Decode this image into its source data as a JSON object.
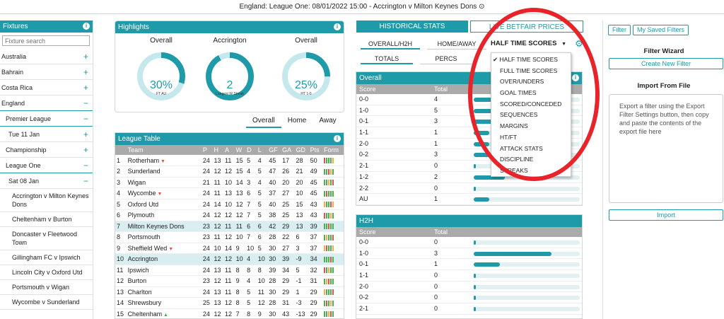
{
  "topbar": {
    "title": "England: League One: 08/01/2022 15:00 - Accrington v Milton Keynes Dons",
    "icon": "clock-icon"
  },
  "fixtures": {
    "title": "Fixtures",
    "search_placeholder": "Fixture search",
    "countries": [
      {
        "label": "Australia",
        "toggle": "+"
      },
      {
        "label": "Bahrain",
        "toggle": "+"
      },
      {
        "label": "Costa Rica",
        "toggle": "+"
      },
      {
        "label": "England",
        "toggle": "−"
      }
    ],
    "leagues": [
      {
        "label": "Premier League",
        "toggle": "−"
      },
      {
        "label": "Tue 11 Jan",
        "toggle": "+"
      },
      {
        "label": "Championship",
        "toggle": "+"
      },
      {
        "label": "League One",
        "toggle": "−"
      },
      {
        "label": "Sat 08 Jan",
        "toggle": "−"
      }
    ],
    "matches": [
      "Accrington v Milton Keynes Dons",
      "Cheltenham v Burton",
      "Doncaster v Fleetwood Town",
      "Gillingham FC v Ipswich",
      "Lincoln City v Oxford Utd",
      "Portsmouth v Wigan",
      "Wycombe v Sunderland"
    ]
  },
  "highlights": {
    "title": "Highlights",
    "gauges": [
      {
        "label": "Overall",
        "value": "30%",
        "sub": "FT AU",
        "pct": 0.3
      },
      {
        "label": "Accrington",
        "value": "2",
        "sub": "Longest W Streak",
        "pct": 0.92
      },
      {
        "label": "Overall",
        "value": "25%",
        "sub": "HT 1-0",
        "pct": 0.25
      }
    ]
  },
  "venue_tabs": [
    "Overall",
    "Home",
    "Away"
  ],
  "league_table": {
    "title": "League Table",
    "headers": [
      "",
      "Team",
      "P",
      "H",
      "A",
      "W",
      "D",
      "L",
      "GF",
      "GA",
      "GD",
      "Pts",
      "Form"
    ],
    "rows": [
      [
        "1",
        "Rotherham",
        "24",
        "13",
        "11",
        "15",
        "5",
        "4",
        "45",
        "17",
        "28",
        "50"
      ],
      [
        "2",
        "Sunderland",
        "24",
        "12",
        "12",
        "15",
        "4",
        "5",
        "47",
        "26",
        "21",
        "49"
      ],
      [
        "3",
        "Wigan",
        "21",
        "11",
        "10",
        "14",
        "3",
        "4",
        "40",
        "20",
        "20",
        "45"
      ],
      [
        "4",
        "Wycombe",
        "24",
        "11",
        "13",
        "13",
        "6",
        "5",
        "37",
        "27",
        "10",
        "45"
      ],
      [
        "5",
        "Oxford Utd",
        "24",
        "14",
        "10",
        "12",
        "7",
        "5",
        "40",
        "25",
        "15",
        "43"
      ],
      [
        "6",
        "Plymouth",
        "24",
        "12",
        "12",
        "12",
        "7",
        "5",
        "38",
        "25",
        "13",
        "43"
      ],
      [
        "7",
        "Milton Keynes Dons",
        "23",
        "12",
        "11",
        "11",
        "6",
        "6",
        "42",
        "29",
        "13",
        "39"
      ],
      [
        "8",
        "Portsmouth",
        "23",
        "11",
        "12",
        "10",
        "7",
        "6",
        "28",
        "22",
        "6",
        "37"
      ],
      [
        "9",
        "Sheffield Wed",
        "24",
        "10",
        "14",
        "9",
        "10",
        "5",
        "30",
        "27",
        "3",
        "37"
      ],
      [
        "10",
        "Accrington",
        "24",
        "12",
        "12",
        "10",
        "4",
        "10",
        "30",
        "39",
        "-9",
        "34"
      ],
      [
        "11",
        "Ipswich",
        "24",
        "13",
        "11",
        "8",
        "8",
        "8",
        "39",
        "34",
        "5",
        "32"
      ],
      [
        "12",
        "Burton",
        "23",
        "12",
        "11",
        "9",
        "4",
        "10",
        "28",
        "29",
        "-1",
        "31"
      ],
      [
        "13",
        "Charlton",
        "24",
        "13",
        "11",
        "8",
        "5",
        "11",
        "30",
        "29",
        "1",
        "29"
      ],
      [
        "14",
        "Shrewsbury",
        "25",
        "13",
        "12",
        "8",
        "5",
        "12",
        "28",
        "31",
        "-3",
        "29"
      ],
      [
        "15",
        "Cheltenham",
        "24",
        "12",
        "12",
        "7",
        "8",
        "9",
        "30",
        "43",
        "-13",
        "29"
      ]
    ],
    "arrows": {
      "1": "down",
      "4": "down",
      "9": "down",
      "15": "up"
    }
  },
  "stats": {
    "tab_hist": "HISTORICAL STATS",
    "tab_live": "LIVE BETFAIR PRICES",
    "sub_overall": "OVERALL/H2H",
    "sub_homeaway": "HOME/AWAY",
    "select_value": "HALF TIME SCORES",
    "totals": "TOTALS",
    "percs": "PERCS",
    "overall_title": "Overall",
    "col_score": "Score",
    "col_total": "Total",
    "overall_rows": [
      [
        "0-0",
        "4"
      ],
      [
        "1-0",
        "5"
      ],
      [
        "0-1",
        "3"
      ],
      [
        "1-1",
        "1"
      ],
      [
        "2-0",
        "1"
      ],
      [
        "0-2",
        "3"
      ],
      [
        "2-1",
        "0"
      ],
      [
        "1-2",
        "2"
      ],
      [
        "2-2",
        "0"
      ],
      [
        "AU",
        "1"
      ]
    ],
    "h2h_title": "H2H",
    "h2h_rows": [
      [
        "0-0",
        "0"
      ],
      [
        "1-0",
        "3"
      ],
      [
        "0-1",
        "1"
      ],
      [
        "1-1",
        "0"
      ],
      [
        "2-0",
        "0"
      ],
      [
        "0-2",
        "0"
      ],
      [
        "2-1",
        "0"
      ]
    ]
  },
  "dropdown": [
    "HALF TIME SCORES",
    "FULL TIME SCORES",
    "OVER/UNDERS",
    "GOAL TIMES",
    "SCORED/CONCEDED",
    "SEQUENCES",
    "MARGINS",
    "HT/FT",
    "ATTACK STATS",
    "DISCIPLINE",
    "STREAKS"
  ],
  "right": {
    "filter_tab": "Filter",
    "saved_tab": "My Saved Filters",
    "wizard_title": "Filter Wizard",
    "create_btn": "Create New Filter",
    "import_title": "Import From File",
    "import_text": "Export a filter using the Export Filter Settings button, then copy and paste the contents of the export file here",
    "import_btn": "Import"
  },
  "colors": {
    "accent": "#1f9aa8",
    "highlight_circle": "#e8242a"
  }
}
